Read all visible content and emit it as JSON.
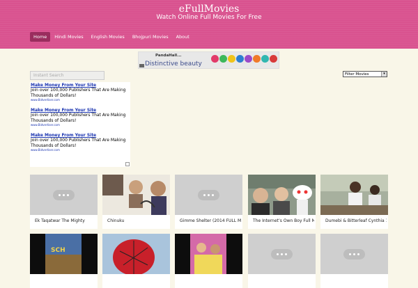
{
  "site": {
    "title": "eFullMovies",
    "tagline": "Watch Online Full Movies For Free"
  },
  "nav": [
    {
      "label": "Home",
      "active": true
    },
    {
      "label": "Hindi Movies",
      "active": false
    },
    {
      "label": "English Movies",
      "active": false
    },
    {
      "label": "Bhojpuri Movies",
      "active": false
    },
    {
      "label": "About",
      "active": false
    }
  ],
  "banner": {
    "logo": "PandaHall...",
    "text": "Distinctive beauty"
  },
  "search": {
    "placeholder": "Instant Search"
  },
  "filter": {
    "selected": "Filter Movies"
  },
  "ads": [
    {
      "title": "Make Money From Your Site",
      "body": "Join over 100,000 Publishers That Are Making Thousands of Dollars!",
      "url": "www.Bidvertiser.com"
    },
    {
      "title": "Make Money From Your Site",
      "body": "Join over 100,000 Publishers That Are Making Thousands of Dollars!",
      "url": "www.Bidvertiser.com"
    },
    {
      "title": "Make Money From Your Site",
      "body": "Join over 100,000 Publishers That Are Making Thousands of Dollars!",
      "url": "www.Bidvertiser.com"
    }
  ],
  "movies": [
    {
      "title": "Ek Taqatwar The Mighty",
      "thumb": "placeholder"
    },
    {
      "title": "Chinuku",
      "thumb": "poster"
    },
    {
      "title": "Gimme Shelter (2014 FULL MOV",
      "thumb": "placeholder"
    },
    {
      "title": "The Internet’s Own Boy Full Mov",
      "thumb": "photo"
    },
    {
      "title": "Dumebi & Bitterleaf Cynthia 1",
      "thumb": "photo"
    },
    {
      "title": "",
      "thumb": "poster"
    },
    {
      "title": "",
      "thumb": "poster"
    },
    {
      "title": "",
      "thumb": "poster"
    },
    {
      "title": "",
      "thumb": "placeholder"
    },
    {
      "title": "",
      "thumb": "placeholder"
    }
  ],
  "colors": {
    "header": "#d9528f",
    "nav_active": "#9a2d5e",
    "page_bg": "#f9f6e8",
    "ad_link": "#1a34b0"
  }
}
